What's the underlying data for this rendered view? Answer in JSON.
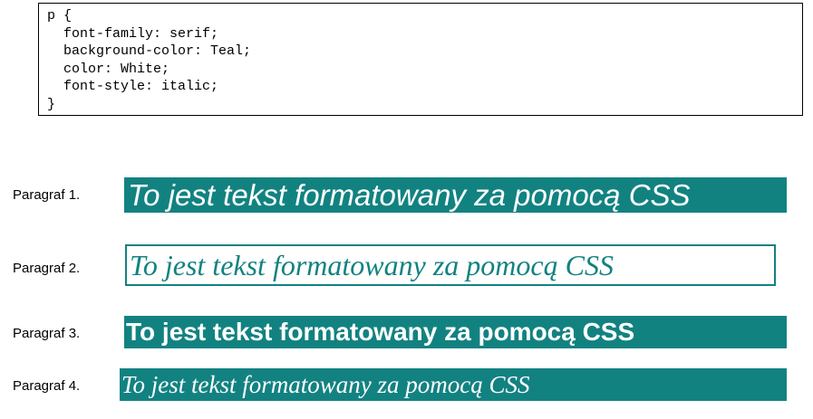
{
  "code": {
    "lines": [
      "p {",
      "  font-family: serif;",
      "  background-color: Teal;",
      "  color: White;",
      "  font-style: italic;",
      "}"
    ]
  },
  "colors": {
    "teal": "#128281",
    "white": "#ffffff"
  },
  "paragraphs": [
    {
      "label": "Paragraf 1.",
      "text": "To jest tekst formatowany za pomocą CSS"
    },
    {
      "label": "Paragraf 2.",
      "text": "To jest tekst formatowany za pomocą CSS"
    },
    {
      "label": "Paragraf 3.",
      "text": "To jest tekst formatowany za pomocą CSS"
    },
    {
      "label": "Paragraf 4.",
      "text": "To jest tekst formatowany za pomocą CSS"
    }
  ]
}
